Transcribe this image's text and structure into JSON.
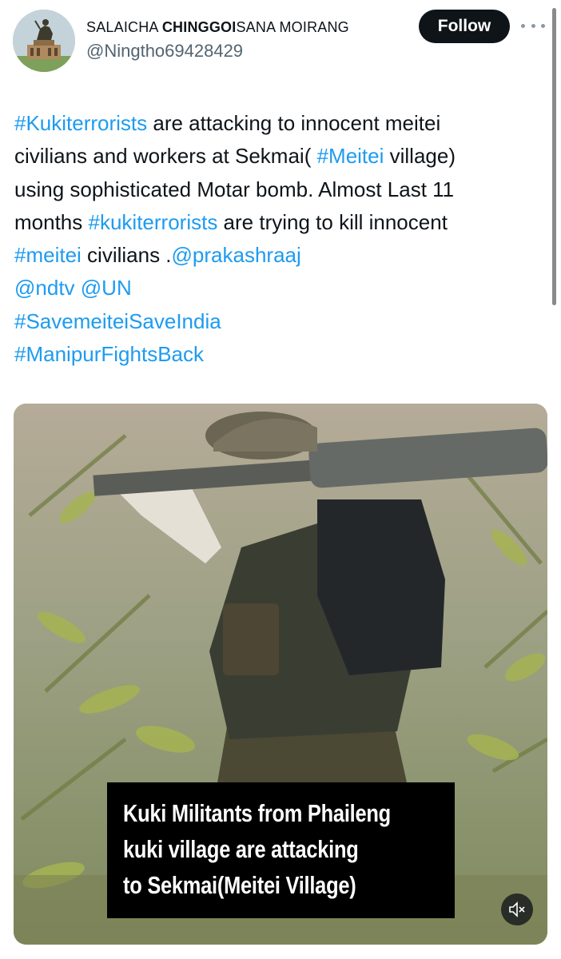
{
  "author": {
    "name_prefix": "SALAICHA ",
    "name_bold": "CHINGGOI",
    "name_suffix": "SANA MOIRANG",
    "handle": "@Ningtho69428429",
    "avatar_icon": "avatar-statue-icon"
  },
  "actions": {
    "follow_label": "Follow",
    "more_icon": "more-options-icon"
  },
  "tweet": {
    "lines": [
      [
        {
          "t": "#Kukiterrorists",
          "tag": true
        },
        {
          "t": " are attacking to innocent meitei",
          "tag": false
        }
      ],
      [
        {
          "t": "civilians and workers at Sekmai( ",
          "tag": false
        },
        {
          "t": "#Meitei",
          "tag": true
        },
        {
          "t": " village)",
          "tag": false
        }
      ],
      [
        {
          "t": "using sophisticated Motar bomb. Almost Last 11",
          "tag": false
        }
      ],
      [
        {
          "t": "months ",
          "tag": false
        },
        {
          "t": "#kukiterrorists",
          "tag": true
        },
        {
          "t": " are trying to kill innocent",
          "tag": false
        }
      ],
      [
        {
          "t": "#meitei",
          "tag": true
        },
        {
          "t": " civilians .",
          "tag": false
        },
        {
          "t": "@prakashraaj",
          "tag": true
        }
      ],
      [
        {
          "t": "@ndtv",
          "tag": true
        },
        {
          "t": " ",
          "tag": false
        },
        {
          "t": "@UN",
          "tag": true
        }
      ],
      [
        {
          "t": "#SavemeiteiSaveIndia",
          "tag": true
        }
      ],
      [
        {
          "t": "#ManipurFightsBack",
          "tag": true
        }
      ]
    ]
  },
  "media": {
    "caption_lines": [
      "Kuki Militants from Phaileng",
      "kuki village are attacking",
      "to Sekmai(Meitei Village)"
    ],
    "mute_icon": "speaker-muted-icon"
  },
  "colors": {
    "link": "#1d9bf0",
    "text": "#0f1419",
    "muted": "#536471",
    "button_bg": "#0f1419"
  }
}
